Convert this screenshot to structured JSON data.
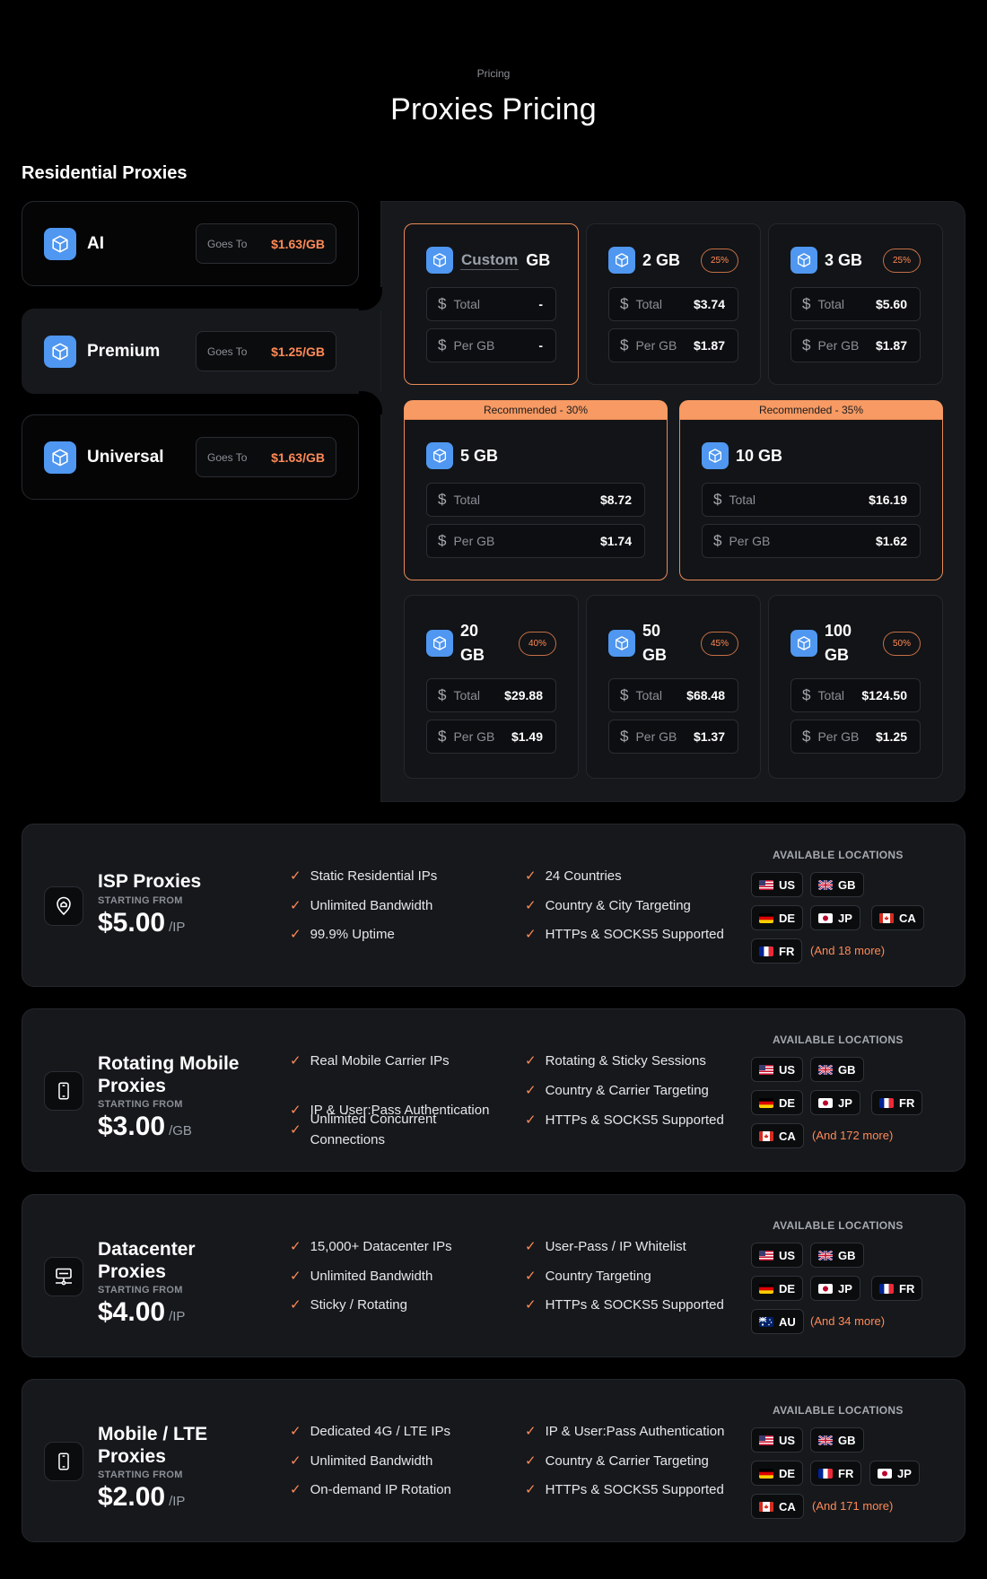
{
  "header": {
    "eyebrow": "Pricing",
    "title": "Proxies Pricing"
  },
  "residential": {
    "section_title": "Residential Proxies",
    "plans": [
      {
        "name": "AI",
        "goes_label": "Goes To",
        "goes_value": "$1.63/GB",
        "icon": "cube-icon"
      },
      {
        "name": "Premium",
        "goes_label": "Goes To",
        "goes_value": "$1.25/GB",
        "icon": "cube-icon",
        "selected": true
      },
      {
        "name": "Universal",
        "goes_label": "Goes To",
        "goes_value": "$1.63/GB",
        "icon": "cube-icon"
      }
    ],
    "labels": {
      "total": "Total",
      "per_gb": "Per GB",
      "currency": "$"
    },
    "custom": {
      "value": "Custom",
      "unit": "GB",
      "total": "-",
      "per_gb": "-"
    },
    "packages": [
      {
        "size": "2 GB",
        "discount": "25%",
        "total": "$3.74",
        "per_gb": "$1.87"
      },
      {
        "size": "3 GB",
        "discount": "25%",
        "total": "$5.60",
        "per_gb": "$1.87"
      },
      {
        "size": "5 GB",
        "recommended": "Recommended - 30%",
        "total": "$8.72",
        "per_gb": "$1.74"
      },
      {
        "size": "10 GB",
        "recommended": "Recommended - 35%",
        "total": "$16.19",
        "per_gb": "$1.62"
      },
      {
        "size_line1": "20",
        "size_line2": "GB",
        "discount": "40%",
        "total": "$29.88",
        "per_gb": "$1.49"
      },
      {
        "size_line1": "50",
        "size_line2": "GB",
        "discount": "45%",
        "total": "$68.48",
        "per_gb": "$1.37"
      },
      {
        "size_line1": "100",
        "size_line2": "GB",
        "discount": "50%",
        "total": "$124.50",
        "per_gb": "$1.25"
      }
    ]
  },
  "products": [
    {
      "name": "ISP Proxies",
      "icon": "location-pin-icon",
      "starting_from": "STARTING FROM",
      "price": "$5.00",
      "unit": "/IP",
      "features_left": [
        "Static Residential IPs",
        "Unlimited Bandwidth",
        "99.9% Uptime"
      ],
      "features_right": [
        "24 Countries",
        "Country & City Targeting",
        "HTTPs & SOCKS5 Supported"
      ],
      "locations_title": "AVAILABLE LOCATIONS",
      "locations": [
        "US",
        "GB",
        "DE",
        "JP",
        "CA",
        "FR"
      ],
      "more": "(And 18 more)"
    },
    {
      "name": "Rotating Mobile Proxies",
      "icon": "smartphone-icon",
      "starting_from": "STARTING FROM",
      "price": "$3.00",
      "unit": "/GB",
      "features_left": [
        "Real Mobile Carrier IPs",
        "IP & User:Pass Authentication",
        "Unlimited Concurrent Connections"
      ],
      "features_right": [
        "Rotating & Sticky Sessions",
        "Country & Carrier Targeting",
        "HTTPs & SOCKS5 Supported"
      ],
      "locations_title": "AVAILABLE LOCATIONS",
      "locations": [
        "US",
        "GB",
        "DE",
        "JP",
        "FR",
        "CA"
      ],
      "more": "(And 172 more)"
    },
    {
      "name": "Datacenter Proxies",
      "icon": "server-icon",
      "starting_from": "STARTING FROM",
      "price": "$4.00",
      "unit": "/IP",
      "features_left": [
        "15,000+ Datacenter IPs",
        "Unlimited Bandwidth",
        "Sticky / Rotating"
      ],
      "features_right": [
        "User-Pass / IP Whitelist",
        "Country Targeting",
        "HTTPs & SOCKS5 Supported"
      ],
      "locations_title": "AVAILABLE LOCATIONS",
      "locations": [
        "US",
        "GB",
        "DE",
        "JP",
        "FR",
        "AU"
      ],
      "more": "(And 34 more)"
    },
    {
      "name": "Mobile / LTE Proxies",
      "icon": "smartphone-icon",
      "starting_from": "STARTING FROM",
      "price": "$2.00",
      "unit": "/IP",
      "features_left": [
        "Dedicated 4G / LTE IPs",
        "Unlimited Bandwidth",
        "On-demand IP Rotation"
      ],
      "features_right": [
        "IP & User:Pass Authentication",
        "Country & Carrier Targeting",
        "HTTPs & SOCKS5 Supported"
      ],
      "locations_title": "AVAILABLE LOCATIONS",
      "locations": [
        "US",
        "GB",
        "DE",
        "FR",
        "JP",
        "CA"
      ],
      "more": "(And 171 more)"
    }
  ],
  "colors": {
    "accent": "#ff8a56",
    "cube": "#4f97f0",
    "panel": "#16181c",
    "recommended": "#f79a63"
  }
}
